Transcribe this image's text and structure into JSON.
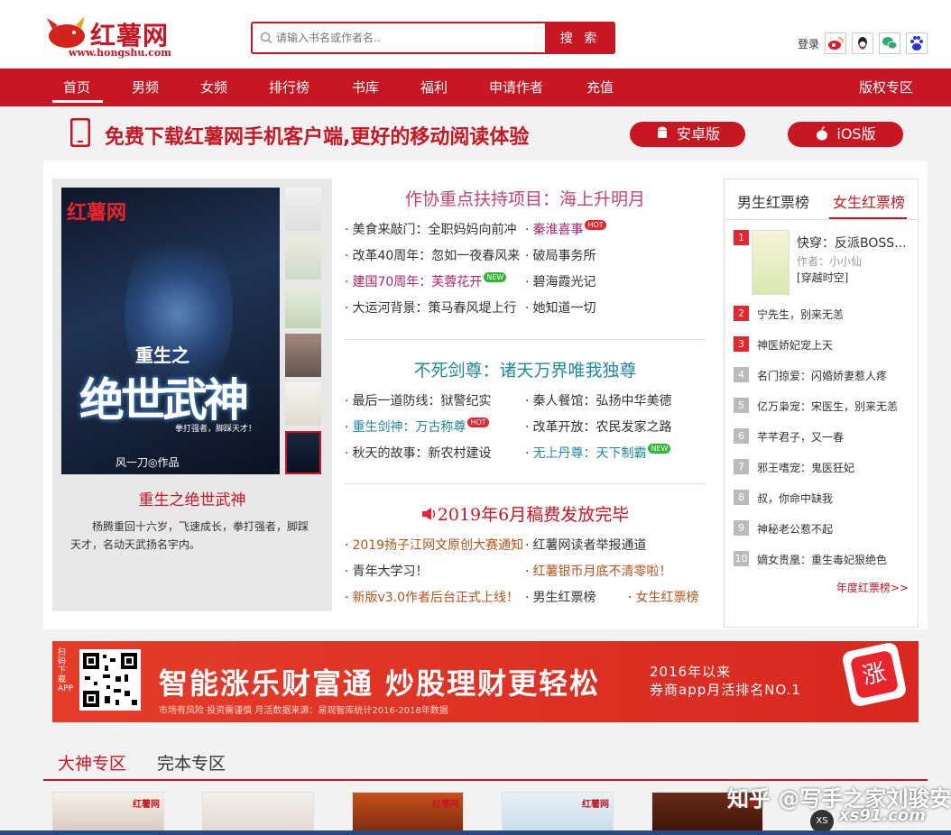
{
  "header": {
    "logo_name": "红薯网",
    "logo_url": "www.hongshu.com",
    "search_placeholder": "请输入书名或作者名..",
    "search_button": "搜 索",
    "login": "登录",
    "social_icons": [
      "weibo-icon",
      "qq-icon",
      "wechat-icon",
      "baidu-icon"
    ]
  },
  "nav": {
    "items": [
      "首页",
      "男频",
      "女频",
      "排行榜",
      "书库",
      "福利",
      "申请作者",
      "充值"
    ],
    "right": "版权专区",
    "active": "首页"
  },
  "app_banner": {
    "message": "免费下载红薯网手机客户端,更好的移动阅读体验",
    "android": "安卓版",
    "ios": "iOS版"
  },
  "feature": {
    "cover_watermark": "红薯网",
    "cover_title_small": "重生之",
    "cover_title_big": "绝世武神",
    "cover_tagline": "拳打强者，脚踩天才！",
    "cover_author": "风一刀◎作品",
    "title": "重生之绝世武神",
    "description": "杨腾重回十六岁，飞速成长，拳打强者，脚踩天才，名动天武扬名宇内。"
  },
  "news": {
    "sections": [
      {
        "heading": "作协重点扶持项目：海上升明月",
        "items": [
          {
            "text": "美食来敲门：全职妈妈向前冲",
            "color": "#333"
          },
          {
            "text": "秦淮喜事",
            "color": "#b4236b",
            "badge": "HOT"
          },
          {
            "text": "改革40周年：忽如一夜春风来",
            "color": "#333"
          },
          {
            "text": "破局事务所",
            "color": "#333"
          },
          {
            "text": "建国70周年：芙蓉花开",
            "color": "#b4236b",
            "badge": "NEW"
          },
          {
            "text": "碧海霞光记",
            "color": "#333"
          },
          {
            "text": "大运河背景：策马春风堤上行",
            "color": "#333"
          },
          {
            "text": "她知道一切",
            "color": "#333"
          }
        ]
      },
      {
        "heading": "不死剑尊：诸天万界唯我独尊",
        "items": [
          {
            "text": "最后一道防线：狱警纪实",
            "color": "#333"
          },
          {
            "text": "秦人餐馆：弘扬中华美德",
            "color": "#333"
          },
          {
            "text": "重生剑神：万古称尊",
            "color": "#1f8a9e",
            "badge": "HOT"
          },
          {
            "text": "改革开放：农民发家之路",
            "color": "#333"
          },
          {
            "text": "秋天的故事：新农村建设",
            "color": "#333"
          },
          {
            "text": "无上丹尊：天下制霸",
            "color": "#1f8a9e",
            "badge": "NEW"
          }
        ]
      },
      {
        "heading": "2019年6月稿费发放完毕",
        "items": [
          {
            "text": "2019扬子江网文原创大赛通知",
            "color": "#b5531a"
          },
          {
            "text": "红薯网读者举报通道",
            "color": "#333"
          },
          {
            "text": "青年大学习！",
            "color": "#333"
          },
          {
            "text": "红薯银币月底不清零啦！",
            "color": "#b5531a"
          },
          {
            "text": "新版v3.0作者后台正式上线！",
            "color": "#b5531a"
          },
          {
            "text": "男生红票榜",
            "color": "#333"
          },
          {
            "text": "女生红票榜",
            "color": "#b5531a"
          }
        ]
      }
    ],
    "heading_colors": [
      "#c8436b",
      "#1f8a9e",
      "#c81623"
    ]
  },
  "ranking": {
    "tabs": [
      "男生红票榜",
      "女生红票榜"
    ],
    "active_tab": "女生红票榜",
    "top_book": {
      "title": "快穿：反派BOSS...",
      "author": "作者：小小仙",
      "category": "[穿越时空]"
    },
    "items": [
      {
        "num": "1",
        "title": "快穿：反派BOSS..."
      },
      {
        "num": "2",
        "title": "宁先生，别来无恙"
      },
      {
        "num": "3",
        "title": "神医娇妃宠上天"
      },
      {
        "num": "4",
        "title": "名门掠爱：闪婚娇妻惹人疼"
      },
      {
        "num": "5",
        "title": "亿万枭宠：宋医生，别来无恙"
      },
      {
        "num": "6",
        "title": "芊芊君子，又一春"
      },
      {
        "num": "7",
        "title": "邪王嗜宠：鬼医狂妃"
      },
      {
        "num": "8",
        "title": "叔，你命中缺我"
      },
      {
        "num": "9",
        "title": "神秘老公惹不起"
      },
      {
        "num": "10",
        "title": "嫡女贵凰：重生毒妃狠绝色"
      }
    ],
    "more": "年度红票榜>>"
  },
  "ad": {
    "vertical": "扫码下载APP",
    "headline": "智能涨乐财富通 炒股理财更轻松",
    "side_line1": "2016年以来",
    "side_line2": "券商app月活排名NO.1",
    "fine_print": "市场有风险 投资需谨慎    月活数据来源：易观智库统计2016-2018年数据",
    "badge": "涨"
  },
  "zones": {
    "tabs": [
      "大神专区",
      "完本专区"
    ],
    "active": "大神专区",
    "card_label": "红薯网"
  },
  "watermark": {
    "text": "知乎 @写手之家刘骏安",
    "site": "xs91.com",
    "logo": "XS"
  }
}
